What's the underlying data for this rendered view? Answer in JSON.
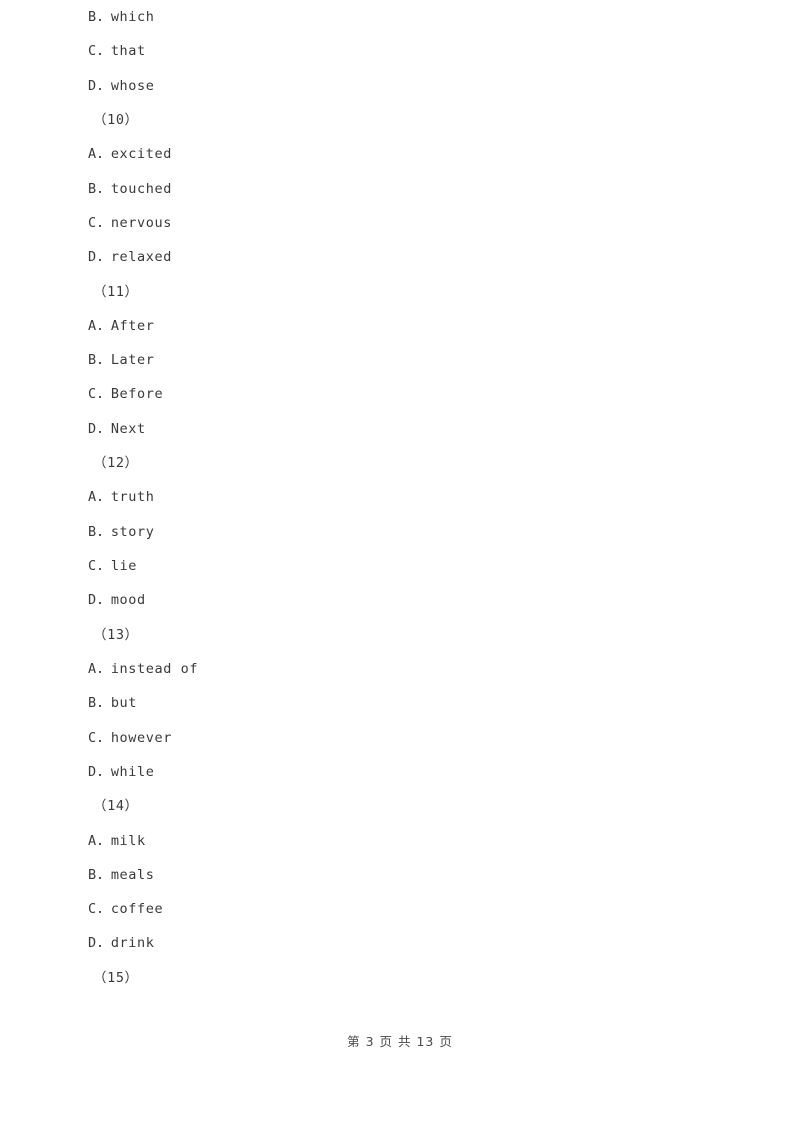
{
  "document": {
    "type": "exam-paper",
    "page_background": "#ffffff",
    "text_color": "#3a3a3a"
  },
  "body_lines": [
    {
      "kind": "option",
      "text": "B．which"
    },
    {
      "kind": "option",
      "text": "C．that"
    },
    {
      "kind": "option",
      "text": "D．whose"
    },
    {
      "kind": "blank-number",
      "text": "（10）"
    },
    {
      "kind": "option",
      "text": "A．excited"
    },
    {
      "kind": "option",
      "text": "B．touched"
    },
    {
      "kind": "option",
      "text": "C．nervous"
    },
    {
      "kind": "option",
      "text": "D．relaxed"
    },
    {
      "kind": "blank-number",
      "text": "（11）"
    },
    {
      "kind": "option",
      "text": "A．After"
    },
    {
      "kind": "option",
      "text": "B．Later"
    },
    {
      "kind": "option",
      "text": "C．Before"
    },
    {
      "kind": "option",
      "text": "D．Next"
    },
    {
      "kind": "blank-number",
      "text": "（12）"
    },
    {
      "kind": "option",
      "text": "A．truth"
    },
    {
      "kind": "option",
      "text": "B．story"
    },
    {
      "kind": "option",
      "text": "C．lie"
    },
    {
      "kind": "option",
      "text": "D．mood"
    },
    {
      "kind": "blank-number",
      "text": "（13）"
    },
    {
      "kind": "option",
      "text": "A．instead of"
    },
    {
      "kind": "option",
      "text": "B．but"
    },
    {
      "kind": "option",
      "text": "C．however"
    },
    {
      "kind": "option",
      "text": "D．while"
    },
    {
      "kind": "blank-number",
      "text": "（14）"
    },
    {
      "kind": "option",
      "text": "A．milk"
    },
    {
      "kind": "option",
      "text": "B．meals"
    },
    {
      "kind": "option",
      "text": "C．coffee"
    },
    {
      "kind": "option",
      "text": "D．drink"
    },
    {
      "kind": "blank-number",
      "text": "（15）"
    }
  ],
  "footer": {
    "text": "第 3 页 共 13 页",
    "current_page": "3",
    "total_pages": "13"
  }
}
